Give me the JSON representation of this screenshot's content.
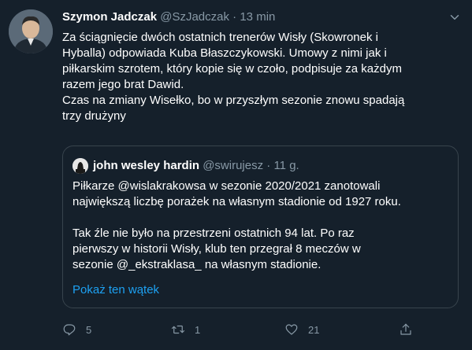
{
  "tweet": {
    "author_name": "Szymon Jadczak",
    "author_handle": "@SzJadczak",
    "separator": "·",
    "time": "13 min",
    "text_lines": [
      "Za ściągnięcie dwóch ostatnich trenerów Wisły (Skowronek i",
      "Hyballa) odpowiada Kuba Błaszczykowski. Umowy z nimi jak i",
      "piłkarskim szrotem, który kopie się w czoło, podpisuje za każdym",
      "razem jego brat Dawid.",
      "Czas na zmiany Wisełko, bo w przyszłym sezonie znowu spadają",
      "trzy drużyny"
    ]
  },
  "quote": {
    "author_name": "john wesley hardin",
    "author_handle": "@swirujesz",
    "separator": "·",
    "time": "11 g.",
    "text_lines": [
      "Piłkarze @wislakrakowsa w sezonie 2020/2021 zanotowali",
      "największą liczbę porażek na własnym stadionie od 1927 roku.",
      "",
      "Tak źle nie było na przestrzeni ostatnich 94 lat.  Po raz",
      "pierwszy w historii Wisły, klub ten przegrał 8 meczów w",
      "sezonie @_ekstraklasa_ na własnym stadionie."
    ],
    "show_thread": "Pokaż ten wątek"
  },
  "actions": {
    "reply_count": "5",
    "retweet_count": "1",
    "like_count": "21",
    "icons": [
      "reply-icon",
      "retweet-icon",
      "like-icon",
      "share-icon"
    ]
  },
  "colors": {
    "background": "#15202b",
    "text": "#ffffff",
    "secondary": "#8899a6",
    "border": "#38444d",
    "link": "#1da1f2"
  }
}
